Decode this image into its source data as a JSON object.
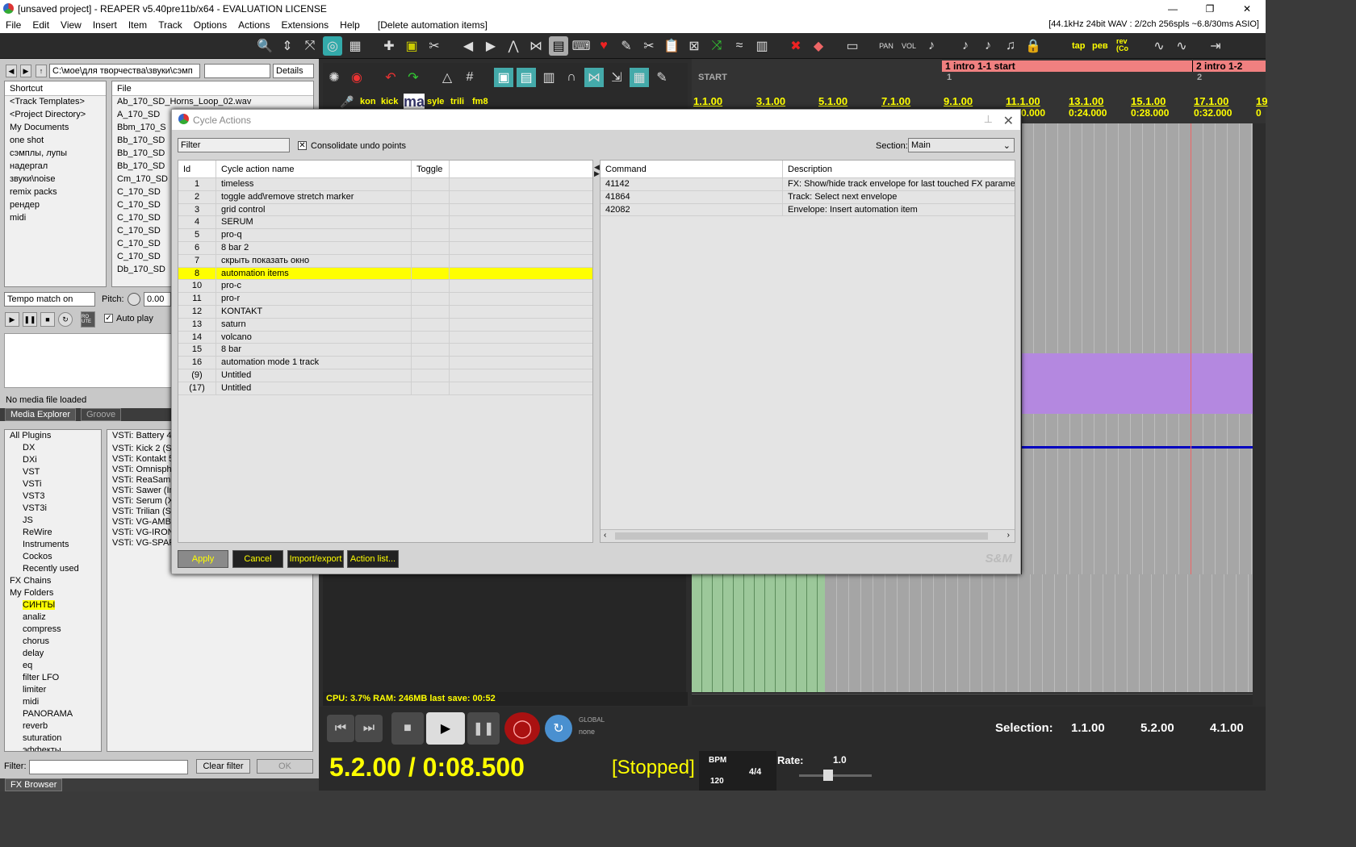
{
  "window": {
    "title": "[unsaved project] - REAPER v5.40pre11b/x64 - EVALUATION LICENSE",
    "minimize": "—",
    "restore": "❐",
    "close": "✕"
  },
  "menu": {
    "items": [
      "File",
      "Edit",
      "View",
      "Insert",
      "Item",
      "Track",
      "Options",
      "Actions",
      "Extensions",
      "Help"
    ],
    "last_action": "[Delete automation items]",
    "audio_status": "[44.1kHz 24bit WAV : 2/2ch 256spls ~6.8/30ms ASIO]"
  },
  "toolbar": {
    "text_buttons": [
      "kon",
      "kick",
      "ma",
      "syle",
      "trili",
      "fm8",
      "tap",
      "рев",
      "rev (Co"
    ]
  },
  "media_explorer": {
    "path": "C:\\мое\\для творчества\\звуки\\сэмп",
    "view_mode": "Details",
    "shortcut_header": "Shortcut",
    "shortcuts": [
      "<Track Templates>",
      "<Project Directory>",
      "My Documents",
      "one shot",
      "сэмплы, лупы",
      "надергал",
      "звуки\\noise",
      "remix packs",
      "рендер",
      "midi"
    ],
    "file_header": "File",
    "files": [
      "Ab_170_SD_Horns_Loop_02.wav",
      "A_170_SD",
      "Bbm_170_S",
      "Bb_170_SD",
      "Bb_170_SD",
      "Bb_170_SD",
      "Cm_170_SD",
      "C_170_SD",
      "C_170_SD",
      "C_170_SD",
      "C_170_SD",
      "C_170_SD",
      "C_170_SD",
      "Db_170_SD"
    ],
    "tempo_mode": "Tempo match on",
    "pitch_label": "Pitch:",
    "pitch_value": "0.00",
    "route": "RO UTE",
    "autoplay_label": "Auto play",
    "status": "No media file loaded",
    "tab_active": "Media Explorer",
    "tab_inactive": "Groove"
  },
  "fx_browser": {
    "tree": [
      "All Plugins",
      "DX",
      "DXi",
      "VST",
      "VSTi",
      "VST3",
      "VST3i",
      "JS",
      "ReWire",
      "Instruments",
      "Cockos",
      "Recently used",
      "FX Chains",
      "My Folders",
      "СИНТЫ",
      "analiz",
      "compress",
      "chorus",
      "delay",
      "eq",
      "filter LFO",
      "limiter",
      "midi",
      "PANORAMA",
      "reverb",
      "suturation",
      "эффекты"
    ],
    "plugins": [
      "VSTi: Battery 4 (N",
      "VSTi: Kick 2 (Son",
      "VSTi: Kontakt 5 (",
      "VSTi: Omnisphere",
      "VSTi: ReaSamplO",
      "VSTi: Sawer (Ima",
      "VSTi: Serum (Xfer",
      "VSTi: Trilian (Spe",
      "VSTi: VG-AMBER",
      "VSTi: VG-IRON (N",
      "VSTi: VG-SPARK"
    ],
    "filter_label": "Filter:",
    "clear_filter": "Clear filter",
    "ok": "OK",
    "tab": "FX Browser"
  },
  "ruler": {
    "markers": [
      {
        "label": "1 intro 1-1 start"
      },
      {
        "label": "2 intro 1-2"
      }
    ],
    "regions": [
      "START",
      "1",
      "2"
    ],
    "bars": [
      "1.1.00",
      "3.1.00",
      "5.1.00",
      "7.1.00",
      "9.1.00",
      "11.1.00",
      "13.1.00",
      "15.1.00",
      "17.1.00",
      "19"
    ],
    "times": [
      "0.000",
      "0:24.000",
      "0:28.000",
      "0:32.000",
      "0"
    ]
  },
  "status": {
    "cpu": "CPU: 3.7%  RAM: 246MB  last save: 00:52",
    "position": "5.2.00 / 0:08.500",
    "state": "[Stopped]",
    "bpm_label": "BPM",
    "bpm": "120",
    "time_sig": "4/4",
    "rate_label": "Rate:",
    "rate": "1.0",
    "selection_label": "Selection:",
    "selection": [
      "1.1.00",
      "5.2.00",
      "4.1.00"
    ],
    "global_label": "GLOBAL",
    "global_mode": "none"
  },
  "cycle_actions": {
    "title": "Cycle Actions",
    "filter_placeholder": "Filter",
    "consolidate_label": "Consolidate undo points",
    "consolidate_checked": true,
    "section_label": "Section:",
    "section_value": "Main",
    "columns": [
      "Id",
      "Cycle action name",
      "Toggle"
    ],
    "rows": [
      {
        "id": "1",
        "name": "timeless"
      },
      {
        "id": "2",
        "name": "toggle add\\remove stretch marker"
      },
      {
        "id": "3",
        "name": "grid control"
      },
      {
        "id": "4",
        "name": "SERUM"
      },
      {
        "id": "5",
        "name": "pro-q"
      },
      {
        "id": "6",
        "name": "8 bar 2"
      },
      {
        "id": "7",
        "name": "скрыть показать окно"
      },
      {
        "id": "8",
        "name": "automation items"
      },
      {
        "id": "10",
        "name": "pro-c"
      },
      {
        "id": "11",
        "name": "pro-r"
      },
      {
        "id": "12",
        "name": "KONTAKT"
      },
      {
        "id": "13",
        "name": "saturn"
      },
      {
        "id": "14",
        "name": "volcano"
      },
      {
        "id": "15",
        "name": "8 bar"
      },
      {
        "id": "16",
        "name": "automation mode 1 track"
      },
      {
        "id": "(9)",
        "name": "Untitled"
      },
      {
        "id": "(17)",
        "name": "Untitled"
      }
    ],
    "selected_id": "8",
    "cmd_columns": [
      "Command",
      "Description"
    ],
    "commands": [
      {
        "command": "41142",
        "description": "FX: Show/hide track envelope for last touched FX parameter"
      },
      {
        "command": "41864",
        "description": "Track: Select next envelope"
      },
      {
        "command": "42082",
        "description": "Envelope: Insert automation item"
      }
    ],
    "buttons": {
      "apply": "Apply",
      "cancel": "Cancel",
      "import_export": "Import/export",
      "action_list": "Action list..."
    },
    "brand": "S&M",
    "colors": {
      "selected_row": "#ffff00",
      "button_text": "#ffff00",
      "button_bg": "#222222"
    }
  }
}
